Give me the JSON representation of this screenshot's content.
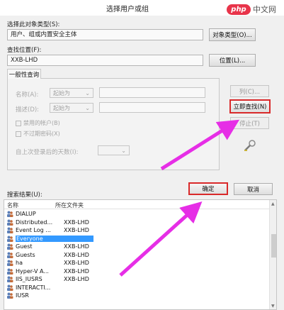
{
  "window": {
    "title": "选择用户或组",
    "close_glyph": "✕"
  },
  "watermark": {
    "logo": "php",
    "text": "中文网"
  },
  "object_type": {
    "label": "选择此对象类型(S):",
    "value": "用户、组或内置安全主体",
    "button": "对象类型(O)..."
  },
  "location": {
    "label": "查找位置(F):",
    "value": "XXB-LHD",
    "button": "位置(L)..."
  },
  "tab": {
    "label": "一般性查询"
  },
  "query": {
    "name_label": "名称(A):",
    "name_mode": "起始为",
    "desc_label": "描述(D):",
    "desc_mode": "起始为",
    "disabled_accounts": "禁用的帐户(B)",
    "no_expire_password": "不过期密码(X)",
    "days_label": "自上次登录后的天数(I):"
  },
  "side_buttons": {
    "columns": "列(C)...",
    "find_now": "立即查找(N)",
    "stop": "停止(T)"
  },
  "actions": {
    "ok": "确定",
    "cancel": "取消"
  },
  "results": {
    "label": "搜索结果(U):",
    "columns": [
      "名称",
      "所在文件夹"
    ],
    "rows": [
      {
        "name": "DIALUP",
        "folder": ""
      },
      {
        "name": "Distributed...",
        "folder": "XXB-LHD"
      },
      {
        "name": "Event Log ...",
        "folder": "XXB-LHD"
      },
      {
        "name": "Everyone",
        "folder": ""
      },
      {
        "name": "Guest",
        "folder": "XXB-LHD"
      },
      {
        "name": "Guests",
        "folder": "XXB-LHD"
      },
      {
        "name": "ha",
        "folder": "XXB-LHD"
      },
      {
        "name": "Hyper-V A...",
        "folder": "XXB-LHD"
      },
      {
        "name": "IIS_IUSRS",
        "folder": "XXB-LHD"
      },
      {
        "name": "INTERACTI...",
        "folder": ""
      },
      {
        "name": "IUSR",
        "folder": ""
      }
    ],
    "selected_index": 3
  },
  "colors": {
    "highlight": "#d9292a",
    "arrow": "#e62ee6",
    "selection": "#3399ff"
  }
}
